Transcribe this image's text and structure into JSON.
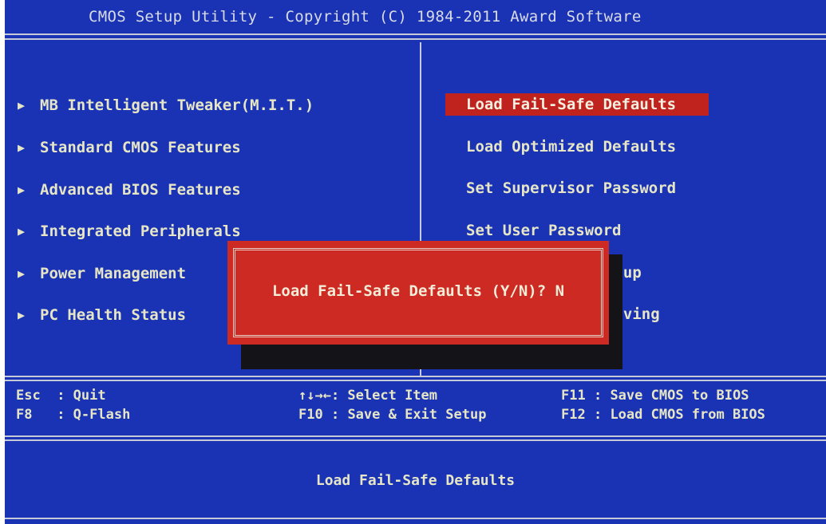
{
  "title": "CMOS Setup Utility - Copyright (C) 1984-2011 Award Software",
  "left_menu": [
    {
      "label": "MB Intelligent Tweaker(M.I.T.)"
    },
    {
      "label": "Standard CMOS Features"
    },
    {
      "label": "Advanced BIOS Features"
    },
    {
      "label": "Integrated Peripherals"
    },
    {
      "label": "Power Management"
    },
    {
      "label": "PC Health Status"
    }
  ],
  "right_menu": [
    {
      "label": "Load Fail-Safe Defaults",
      "selected": true
    },
    {
      "label": "Load Optimized Defaults"
    },
    {
      "label": "Set Supervisor Password"
    },
    {
      "label": "Set User Password"
    },
    {
      "label": "etup"
    },
    {
      "label": "Saving"
    }
  ],
  "dialog": {
    "prompt": "Load Fail-Safe Defaults (Y/N)? N"
  },
  "help": {
    "esc_key": "Esc",
    "esc_action": ": Quit",
    "f8_key": "F8",
    "f8_action": ": Q-Flash",
    "nav_keys": "↑↓→←",
    "nav_action": ": Select Item",
    "f10_key": "F10",
    "f10_action": ": Save & Exit Setup",
    "f11_key": "F11",
    "f11_action": ": Save CMOS to BIOS",
    "f12_key": "F12",
    "f12_action": ": Load CMOS from BIOS"
  },
  "status_description": "Load Fail-Safe Defaults",
  "colors": {
    "background": "#1a33b4",
    "highlight": "#c0231d",
    "text": "#e6e6c6",
    "dialog": "#cc2a22"
  }
}
